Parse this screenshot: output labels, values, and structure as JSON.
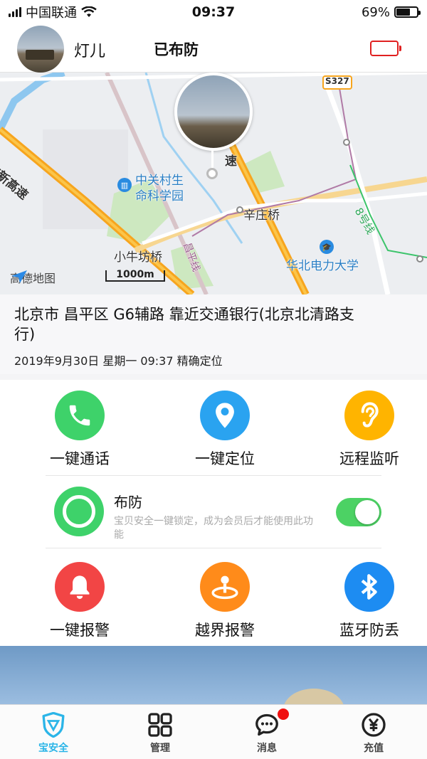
{
  "status_bar": {
    "carrier": "中国联通",
    "time": "09:37",
    "battery": "69%"
  },
  "header": {
    "name": "灯儿",
    "status": "已布防"
  },
  "map": {
    "labels": {
      "highway": "京新高速",
      "speed": "速",
      "s327": "S327",
      "poi_park": "中关村生命科学园",
      "poi_park_l1": "中关村生",
      "poi_park_l2": "命科学园",
      "xinzhuang": "辛庄桥",
      "line8": "8号线",
      "xiaoniu": "小牛坊桥",
      "changping": "昌平线",
      "ncepu": "华北电力大学"
    },
    "logo": "高德地图",
    "scale": "1000m"
  },
  "address": {
    "main": "北京市 昌平区 G6辅路 靠近交通银行(北京北清路支行)",
    "meta": "2019年9月30日 星期一 09:37 精确定位"
  },
  "actions": {
    "call": "一键通话",
    "locate": "一键定位",
    "monitor": "远程监听",
    "arm_title": "布防",
    "arm_desc": "宝贝安全一键锁定，成为会员后才能使用此功能",
    "arm_enabled": true,
    "sos": "一键报警",
    "fence": "越界报警",
    "bluetooth": "蓝牙防丢"
  },
  "tabs": [
    {
      "label": "宝安全",
      "icon": "shield-icon",
      "active": true
    },
    {
      "label": "管理",
      "icon": "grid-icon",
      "active": false
    },
    {
      "label": "消息",
      "icon": "message-icon",
      "active": false
    },
    {
      "label": "充值",
      "icon": "yuan-icon",
      "active": false
    }
  ],
  "colors": {
    "green": "#3ed26a",
    "blue": "#2aa3f0",
    "amber": "#ffb400",
    "red": "#f24545",
    "orange": "#ff8b1a",
    "bt_blue": "#1d8cf2",
    "accent": "#2bb5e8"
  }
}
